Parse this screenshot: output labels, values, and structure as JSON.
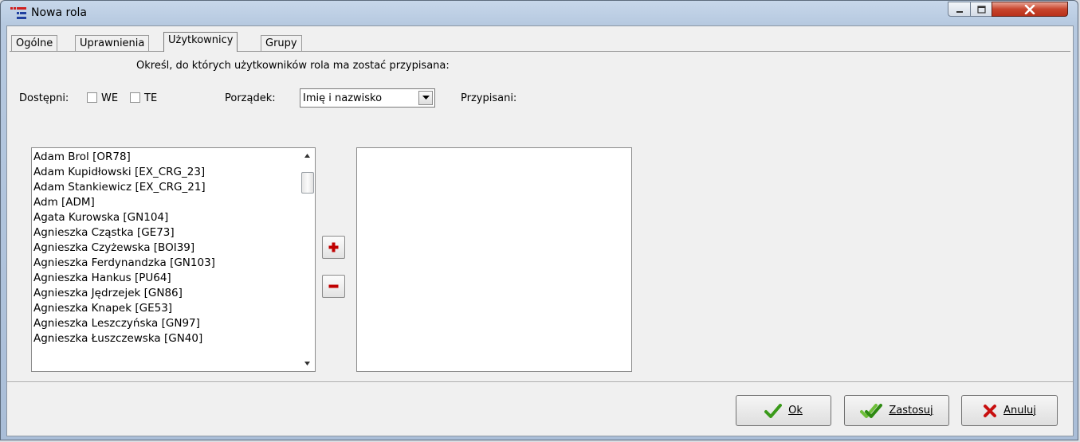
{
  "window": {
    "title": "Nowa rola",
    "icon": "app-icon",
    "controls": {
      "minimize": "minimize-icon",
      "maximize": "maximize-icon",
      "close": "close-icon"
    }
  },
  "tabs": [
    {
      "label": "Ogólne",
      "active": false
    },
    {
      "label": "Uprawnienia",
      "active": false
    },
    {
      "label": "Użytkownicy",
      "active": true
    },
    {
      "label": "Grupy",
      "active": false
    }
  ],
  "panel": {
    "instruction": "Określ, do których użytkowników rola ma zostać przypisana:",
    "available_label": "Dostępni:",
    "filter_we": {
      "label": "WE",
      "checked": false
    },
    "filter_te": {
      "label": "TE",
      "checked": false
    },
    "order_label": "Porządek:",
    "order_value": "Imię i nazwisko",
    "assigned_label": "Przypisani:",
    "available_users": [
      "Adam Brol [OR78]",
      "Adam Kupidłowski [EX_CRG_23]",
      "Adam Stankiewicz [EX_CRG_21]",
      "Adm [ADM]",
      "Agata Kurowska [GN104]",
      "Agnieszka Cząstka [GE73]",
      "Agnieszka Czyżewska [BOI39]",
      "Agnieszka Ferdynandzka [GN103]",
      "Agnieszka Hankus [PU64]",
      "Agnieszka Jędrzejek [GN86]",
      "Agnieszka Knapek [GE53]",
      "Agnieszka Leszczyńska [GN97]",
      "Agnieszka Łuszczewska [GN40]"
    ],
    "assigned_users": [],
    "add_icon": "plus-icon",
    "remove_icon": "minus-icon"
  },
  "buttons": {
    "ok": {
      "label": "Ok",
      "icon": "check-icon"
    },
    "apply": {
      "label": "Zastosuj",
      "icon": "double-check-icon"
    },
    "cancel": {
      "label": "Anuluj",
      "icon": "x-icon"
    }
  },
  "colors": {
    "add_red": "#c00000",
    "check_green": "#3a9a1a",
    "cancel_red": "#c81010"
  }
}
